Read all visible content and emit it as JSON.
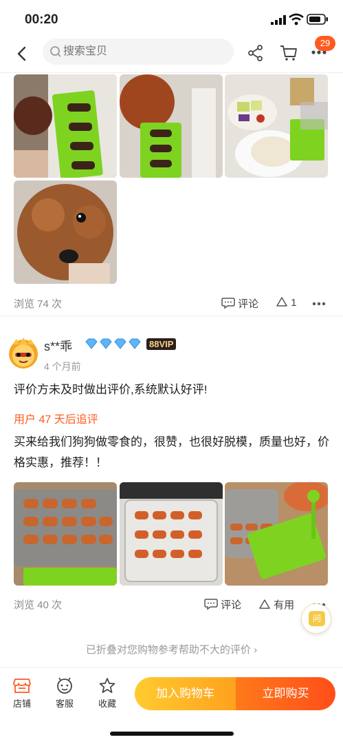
{
  "status": {
    "time": "00:20"
  },
  "nav": {
    "search_placeholder": "搜索宝贝",
    "badge_count": "29"
  },
  "review1": {
    "views": "浏览 74 次",
    "comment_label": "评论",
    "like_count": "1"
  },
  "review2": {
    "username": "s**乖",
    "vip_badge": "88VIP",
    "time": "4 个月前",
    "default_text": "评价方未及时做出评价,系统默认好评!",
    "followup_label": "用户 47 天后追评",
    "followup_text": "买来给我们狗狗做零食的，很赞，也很好脱模，质量也好，价格实惠，推荐！！",
    "views": "浏览 40 次",
    "comment_label": "评论",
    "useful_label": "有用"
  },
  "folded_text": "已折叠对您购物参考帮助不大的评价 ›",
  "float_label": "问",
  "bottom": {
    "store_label": "店铺",
    "service_label": "客服",
    "fav_label": "收藏",
    "add_cart_label": "加入购物车",
    "buy_label": "立即购买"
  },
  "colors": {
    "accent": "#ff5a1f",
    "cart_btn": "#ffb627",
    "buy_btn": "#ff5a1f"
  }
}
